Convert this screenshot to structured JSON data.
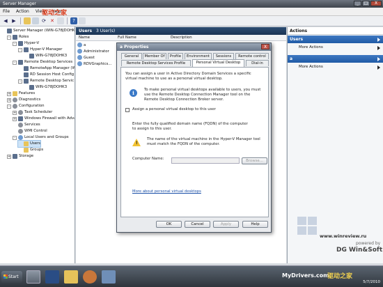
{
  "window": {
    "title": "Server Manager",
    "watermark": "驱动之家",
    "buttons": [
      "_",
      "□",
      "X"
    ]
  },
  "menubar": [
    "File",
    "Action",
    "View",
    "Help"
  ],
  "tree": [
    {
      "label": "Server Manager (WIN-G78JDOHK3)",
      "indent": 0,
      "exp": "",
      "icon": "srv"
    },
    {
      "label": "Roles",
      "indent": 1,
      "exp": "-",
      "icon": "srv"
    },
    {
      "label": "Hyper-V",
      "indent": 2,
      "exp": "-",
      "icon": "srv"
    },
    {
      "label": "Hyper-V Manager",
      "indent": 3,
      "exp": "-",
      "icon": "srv"
    },
    {
      "label": "WIN-G78JDOHK3",
      "indent": 4,
      "exp": "",
      "icon": "srv"
    },
    {
      "label": "Remote Desktop Services",
      "indent": 2,
      "exp": "-",
      "icon": "srv"
    },
    {
      "label": "RemoteApp Manager (W",
      "indent": 3,
      "exp": "",
      "icon": "srv"
    },
    {
      "label": "RD Session Host Config",
      "indent": 3,
      "exp": "",
      "icon": "srv"
    },
    {
      "label": "Remote Desktop Servic",
      "indent": 3,
      "exp": "-",
      "icon": "srv"
    },
    {
      "label": "WIN-G78JDOHK3",
      "indent": 4,
      "exp": "",
      "icon": "srv"
    },
    {
      "label": "Features",
      "indent": 1,
      "exp": "+",
      "icon": "fld"
    },
    {
      "label": "Diagnostics",
      "indent": 1,
      "exp": "+",
      "icon": "gear"
    },
    {
      "label": "Configuration",
      "indent": 1,
      "exp": "-",
      "icon": "gear"
    },
    {
      "label": "Task Scheduler",
      "indent": 2,
      "exp": "+",
      "icon": "gear"
    },
    {
      "label": "Windows Firewall with Adva",
      "indent": 2,
      "exp": "+",
      "icon": "srv"
    },
    {
      "label": "Services",
      "indent": 2,
      "exp": "",
      "icon": "gear"
    },
    {
      "label": "WMI Control",
      "indent": 2,
      "exp": "",
      "icon": "gear"
    },
    {
      "label": "Local Users and Groups",
      "indent": 2,
      "exp": "-",
      "icon": "usr"
    },
    {
      "label": "Users",
      "indent": 3,
      "exp": "",
      "icon": "fld",
      "selected": true
    },
    {
      "label": "Groups",
      "indent": 3,
      "exp": "",
      "icon": "fld"
    },
    {
      "label": "Storage",
      "indent": 1,
      "exp": "+",
      "icon": "srv"
    }
  ],
  "middle": {
    "title": "Users",
    "count": "3 User(s)",
    "columns": [
      "Name",
      "Full Name",
      "Description"
    ],
    "rows": [
      "a",
      "Administrator",
      "Guest",
      "RDVGraphics..."
    ]
  },
  "actions": {
    "title": "Actions",
    "groups": [
      {
        "label": "Users",
        "item": "More Actions"
      },
      {
        "label": "a",
        "item": "More Actions"
      }
    ]
  },
  "dialog": {
    "title": "a Properties",
    "close": "X",
    "tabs_row1": [
      "General",
      "Member Of",
      "Profile",
      "Environment",
      "Sessions",
      "Remote control"
    ],
    "tabs_row2": [
      "Remote Desktop Services Profile",
      "Personal Virtual Desktop",
      "Dial-in"
    ],
    "intro": "You can assign a user in Active Directory Domain Services a specific virtual machine to use as a personal virtual desktop.",
    "info": "To make personal virtual desktops available to users, you must use the Remote Desktop Connection Manager tool on the Remote Desktop Connection Broker server.",
    "checkbox": "Assign a personal virtual desktop to this user",
    "fqdn_prompt": "Enter the fully qualified domain name (FQDN) of the computer to assign to this user.",
    "warning": "The name of the virtual machine in the Hyper-V Manager tool must match the FQDN of the computer.",
    "computer_label": "Computer Name:",
    "browse": "Browse...",
    "link": "More about personal virtual desktops",
    "buttons": [
      "OK",
      "Cancel",
      "Apply",
      "Help"
    ]
  },
  "branding": {
    "site": "www.winreview.ru",
    "powered": "powered by",
    "company": "DG Win&Soft",
    "footer_site": "MyDrivers.com",
    "footer_cn": "驱动之家"
  },
  "taskbar": {
    "start": "Start",
    "date": "5/7/2010"
  }
}
